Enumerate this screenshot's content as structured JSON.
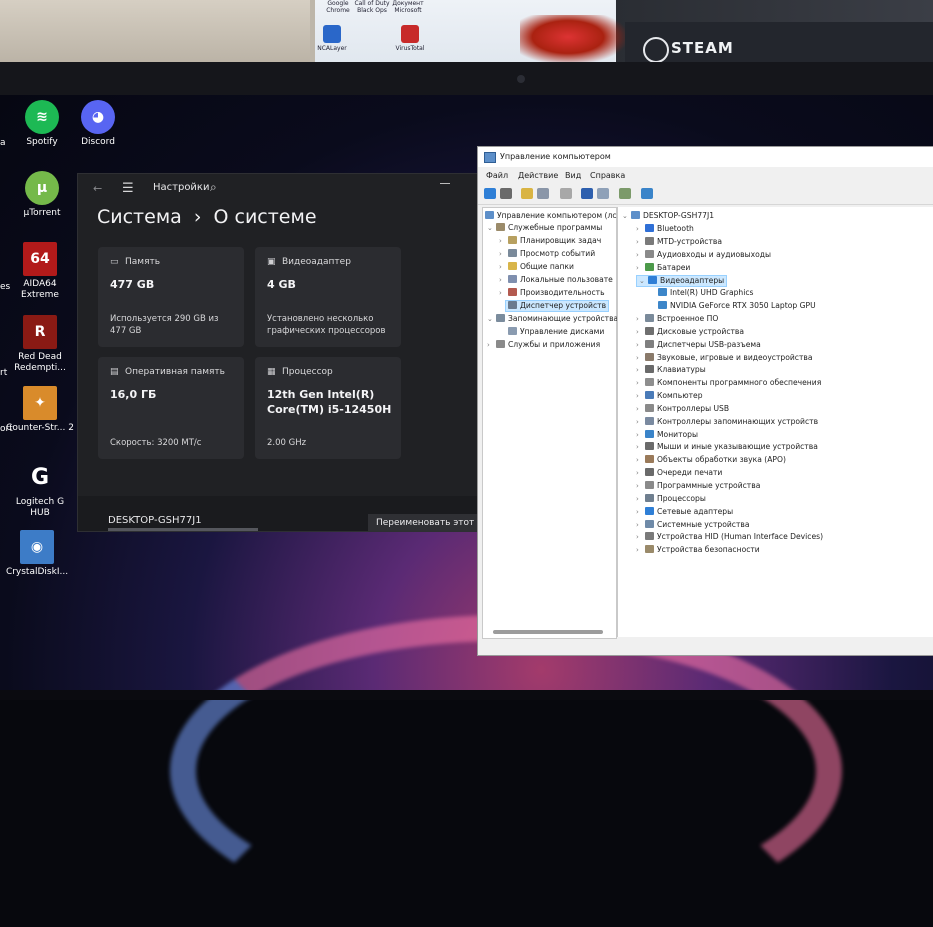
{
  "photo_top": {
    "steam_label": "STEAM",
    "top_icons": [
      "Google Chrome",
      "Call of Duty Black Ops",
      "Документ Microsoft",
      "NCALayer",
      "VirusTotal"
    ]
  },
  "desktop_icons": [
    {
      "label": "Spotify",
      "icon": "spotify-icon",
      "color": "#1db954"
    },
    {
      "label": "Discord",
      "icon": "discord-icon",
      "color": "#5865f2"
    },
    {
      "label": "µTorrent",
      "icon": "utorrent-icon",
      "color": "#75b94a"
    },
    {
      "label": "AIDA64 Extreme",
      "icon": "aida64-icon",
      "color": "#b21a1a"
    },
    {
      "label": "Red Dead Redempti...",
      "icon": "red-dead-icon",
      "color": "#8a1a14"
    },
    {
      "label": "Counter-Str... 2",
      "icon": "counter-strike-icon",
      "color": "#d98b2b"
    },
    {
      "label": "Logitech G HUB",
      "icon": "logitech-icon",
      "color": "#1c1c1c"
    },
    {
      "label": "CrystalDiskI...",
      "icon": "crystaldisk-icon",
      "color": "#3d7cc7"
    }
  ],
  "edge_labels": [
    "a",
    "es",
    "ort",
    "rt"
  ],
  "settings": {
    "app_title": "Настройки",
    "breadcrumb_parent": "Система",
    "breadcrumb_sep": "›",
    "breadcrumb_current": "О системе",
    "cards": {
      "storage": {
        "title": "Память",
        "value": "477 GB",
        "sub": "Используется 290 GB из 477 GB"
      },
      "gpu": {
        "title": "Видеоадаптер",
        "value": "4 GB",
        "sub": "Установлено несколько графических процессоров"
      },
      "ram": {
        "title": "Оперативная память",
        "value": "16,0 ГБ",
        "sub": "Скорость: 3200 МТ/с"
      },
      "cpu": {
        "title": "Процессор",
        "value": "12th Gen Intel(R) Core(TM) i5-12450H",
        "sub": "2.00 GHz"
      }
    },
    "device_name": "DESKTOP-GSH77J1",
    "rename_label": "Переименовать этот П"
  },
  "computer_management": {
    "title": "Управление компьютером",
    "menu": [
      "Файл",
      "Действие",
      "Вид",
      "Справка"
    ],
    "left_tree": [
      {
        "label": "Управление компьютером (лс",
        "level": 0,
        "exp": ""
      },
      {
        "label": "Служебные программы",
        "level": 1,
        "exp": "⌄"
      },
      {
        "label": "Планировщик задач",
        "level": 2,
        "exp": "›"
      },
      {
        "label": "Просмотр событий",
        "level": 2,
        "exp": "›"
      },
      {
        "label": "Общие папки",
        "level": 2,
        "exp": "›"
      },
      {
        "label": "Локальные пользовате",
        "level": 2,
        "exp": "›"
      },
      {
        "label": "Производительность",
        "level": 2,
        "exp": "›"
      },
      {
        "label": "Диспетчер устройств",
        "level": 2,
        "exp": "",
        "selected": true
      },
      {
        "label": "Запоминающие устройства",
        "level": 1,
        "exp": "⌄"
      },
      {
        "label": "Управление дисками",
        "level": 2,
        "exp": ""
      },
      {
        "label": "Службы и приложения",
        "level": 1,
        "exp": "›"
      }
    ],
    "device_root": "DESKTOP-GSH77J1",
    "devices": [
      {
        "label": "Bluetooth",
        "exp": "›",
        "level": 1
      },
      {
        "label": "MTD-устройства",
        "exp": "›",
        "level": 1
      },
      {
        "label": "Аудиовходы и аудиовыходы",
        "exp": "›",
        "level": 1
      },
      {
        "label": "Батареи",
        "exp": "›",
        "level": 1
      },
      {
        "label": "Видеоадаптеры",
        "exp": "⌄",
        "level": 1,
        "selected": true
      },
      {
        "label": "Intel(R) UHD Graphics",
        "exp": "",
        "level": 2
      },
      {
        "label": "NVIDIA GeForce RTX 3050 Laptop GPU",
        "exp": "",
        "level": 2
      },
      {
        "label": "Встроенное ПО",
        "exp": "›",
        "level": 1
      },
      {
        "label": "Дисковые устройства",
        "exp": "›",
        "level": 1
      },
      {
        "label": "Диспетчеры USB-разъема",
        "exp": "›",
        "level": 1
      },
      {
        "label": "Звуковые, игровые и видеоустройства",
        "exp": "›",
        "level": 1
      },
      {
        "label": "Клавиатуры",
        "exp": "›",
        "level": 1
      },
      {
        "label": "Компоненты программного обеспечения",
        "exp": "›",
        "level": 1
      },
      {
        "label": "Компьютер",
        "exp": "›",
        "level": 1
      },
      {
        "label": "Контроллеры USB",
        "exp": "›",
        "level": 1
      },
      {
        "label": "Контроллеры запоминающих устройств",
        "exp": "›",
        "level": 1
      },
      {
        "label": "Мониторы",
        "exp": "›",
        "level": 1
      },
      {
        "label": "Мыши и иные указывающие устройства",
        "exp": "›",
        "level": 1
      },
      {
        "label": "Объекты обработки звука (APO)",
        "exp": "›",
        "level": 1
      },
      {
        "label": "Очереди печати",
        "exp": "›",
        "level": 1
      },
      {
        "label": "Программные устройства",
        "exp": "›",
        "level": 1
      },
      {
        "label": "Процессоры",
        "exp": "›",
        "level": 1
      },
      {
        "label": "Сетевые адаптеры",
        "exp": "›",
        "level": 1
      },
      {
        "label": "Системные устройства",
        "exp": "›",
        "level": 1
      },
      {
        "label": "Устройства HID (Human Interface Devices)",
        "exp": "›",
        "level": 1
      },
      {
        "label": "Устройства безопасности",
        "exp": "›",
        "level": 1
      }
    ]
  }
}
